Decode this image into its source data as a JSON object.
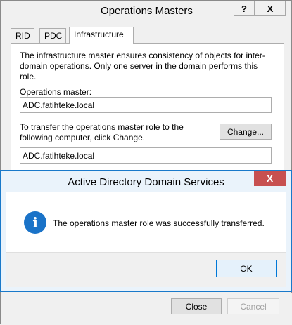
{
  "window": {
    "title": "Operations Masters",
    "help_glyph": "?",
    "close_glyph": "X"
  },
  "tabs": [
    {
      "label": "RID"
    },
    {
      "label": "PDC"
    },
    {
      "label": "Infrastructure"
    }
  ],
  "panel": {
    "description": "The infrastructure master ensures consistency of objects for inter-domain operations. Only one server in the domain performs this role.",
    "ops_master_label": "Operations master:",
    "ops_master_value": "ADC.fatihteke.local",
    "transfer_text": "To transfer the operations master role to the following computer, click Change.",
    "change_button": "Change...",
    "target_value": "ADC.fatihteke.local"
  },
  "footer": {
    "close_button": "Close",
    "cancel_button": "Cancel"
  },
  "dialog": {
    "title": "Active Directory Domain Services",
    "close_glyph": "X",
    "message": "The operations master role was successfully transferred.",
    "ok_button": "OK",
    "info_glyph": "i"
  }
}
